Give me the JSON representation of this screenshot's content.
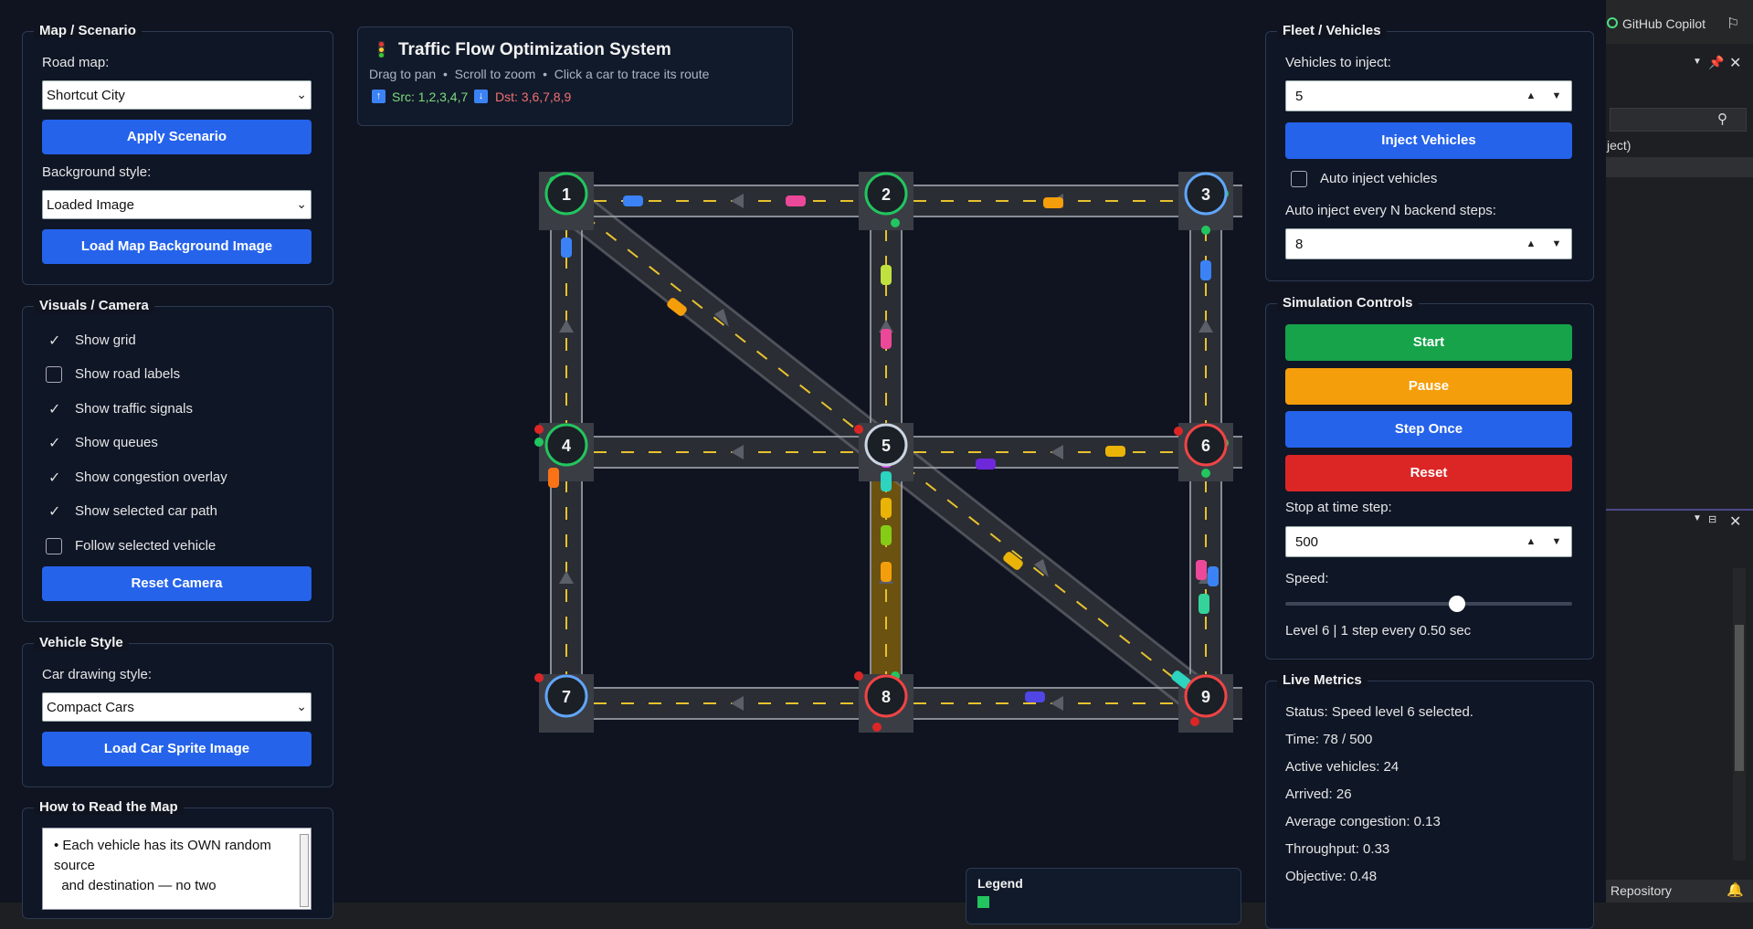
{
  "left": {
    "map_title": "Map / Scenario",
    "road_map_label": "Road map:",
    "road_map_value": "Shortcut City",
    "apply_button": "Apply Scenario",
    "bg_label": "Background style:",
    "bg_value": "Loaded Image",
    "load_bg_button": "Load Map Background Image",
    "visuals_title": "Visuals / Camera",
    "checks": [
      {
        "label": "Show grid",
        "checked": true
      },
      {
        "label": "Show road labels",
        "checked": false
      },
      {
        "label": "Show traffic signals",
        "checked": true
      },
      {
        "label": "Show queues",
        "checked": true
      },
      {
        "label": "Show congestion overlay",
        "checked": true
      },
      {
        "label": "Show selected car path",
        "checked": true
      },
      {
        "label": "Follow selected vehicle",
        "checked": false
      }
    ],
    "reset_camera_button": "Reset Camera",
    "vehicle_title": "Vehicle Style",
    "car_style_label": "Car drawing style:",
    "car_style_value": "Compact Cars",
    "load_sprite_button": "Load Car Sprite Image",
    "howto_title": "How to Read the Map",
    "howto_line1": "• Each vehicle has its OWN random",
    "howto_line2": "source",
    "howto_line3": "  and destination — no two"
  },
  "header": {
    "title": "Traffic Flow Optimization System",
    "subtitle": "Drag to pan  •  Scroll to zoom  •  Click a car to trace its route",
    "src": "Src: 1,2,3,4,7",
    "dst": "Dst: 3,6,7,8,9"
  },
  "nodes": [
    "1",
    "2",
    "3",
    "4",
    "5",
    "6",
    "7",
    "8",
    "9"
  ],
  "legend": {
    "title": "Legend"
  },
  "right": {
    "fleet_title": "Fleet / Vehicles",
    "inject_label": "Vehicles to inject:",
    "inject_value": "5",
    "inject_button": "Inject Vehicles",
    "auto_inject_label": "Auto inject vehicles",
    "auto_every_label": "Auto inject every N backend steps:",
    "auto_every_value": "8",
    "sim_title": "Simulation Controls",
    "start": "Start",
    "pause": "Pause",
    "step": "Step Once",
    "reset": "Reset",
    "stop_label": "Stop at time step:",
    "stop_value": "500",
    "speed_label": "Speed:",
    "speed_level": 0.6,
    "speed_text": "Level 6 | 1 step every 0.50 sec",
    "metrics_title": "Live Metrics",
    "metrics": [
      "Status: Speed level 6 selected.",
      "Time: 78 / 500",
      "Active vehicles: 24",
      "Arrived: 26",
      "Average congestion: 0.13",
      "Throughput: 0.33",
      "Objective: 0.48"
    ]
  },
  "ide": {
    "copilot": "GitHub Copilot",
    "ject": "ject)",
    "repo": "Repository"
  }
}
